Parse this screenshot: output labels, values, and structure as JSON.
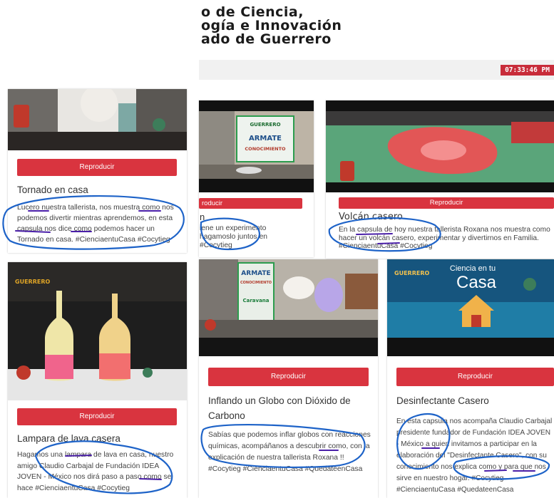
{
  "header": {
    "title_line1": "o de Ciencia,",
    "title_line2": "ogía e Innovación",
    "title_line3": "ado de Guerrero",
    "clock": "07:33:46 PM"
  },
  "cards": [
    {
      "button": "Reproducir",
      "title": "Tornado en casa",
      "description": "Lucero nuestra tallerista, nos muestra como nos podemos divertir mientras aprendemos, en esta capsula nos dice como podemos hacer un Tornado en casa. #CienciaentuCasa #Cocytieg"
    },
    {
      "button": "roducir",
      "title": "n",
      "description": "iene un experimento hagamoslo juntos en #Cocytieg",
      "thumb_sign": [
        "GUERRERO",
        "ARMATE",
        "CONOCIMIENTO"
      ]
    },
    {
      "button": "Reproducir",
      "title": "Volcán casero",
      "description": "En la capsula de hoy nuestra tallerista Roxana nos muestra como hacer un volcán casero, experimentar y divertirnos en Familia. #CienciaentuCasa #Cocytieg"
    },
    {
      "button": "Reproducir",
      "title": "Lampara de lava casera",
      "description": "Hagamos una lampara de lava en casa, nuestro amigo Claudio Carbajal de Fundación IDEA JOVEN - México nos dirá paso a paso como se hace #CienciaentuCasa #Cocytieg",
      "thumb_logo": "GUERRERO"
    },
    {
      "button": "Reproducir",
      "title_line1": "Inflando un Globo con Dióxido de",
      "title_line2": "Carbono",
      "description": "Sabías que podemos inflar globos con reacciones químicas, acompáñanos a descubrir como, con la explicación de nuestra tallerista Roxana !! #Cocytieg #CienciaentuCasa #QuedateenCasa",
      "thumb_sign": [
        "ARMATE",
        "CONOCIMIENTO",
        "Caravana"
      ]
    },
    {
      "button": "Reproducir",
      "title": "Desinfectante Casero",
      "description": "En esta capsula nos acompaña Claudio Carbajal presidente fundador de Fundación IDEA JOVEN - México a quien invitamos a participar en la elaboración del \"Desinfectante Casero\", con su conocimiento nos explica como y para que nos sirve en nuestro hogar. #Cocytieg #CienciaentuCasa #QuedateenCasa",
      "thumb_text1": "Ciencia en tu",
      "thumb_text2": "Casa",
      "thumb_logo": "GUERRERO"
    }
  ],
  "colors": {
    "button_red": "#d9343f",
    "clock_red": "#c82c3a",
    "annotation_blue": "#1e63c8",
    "annotation_purple": "#4a1fa8"
  }
}
